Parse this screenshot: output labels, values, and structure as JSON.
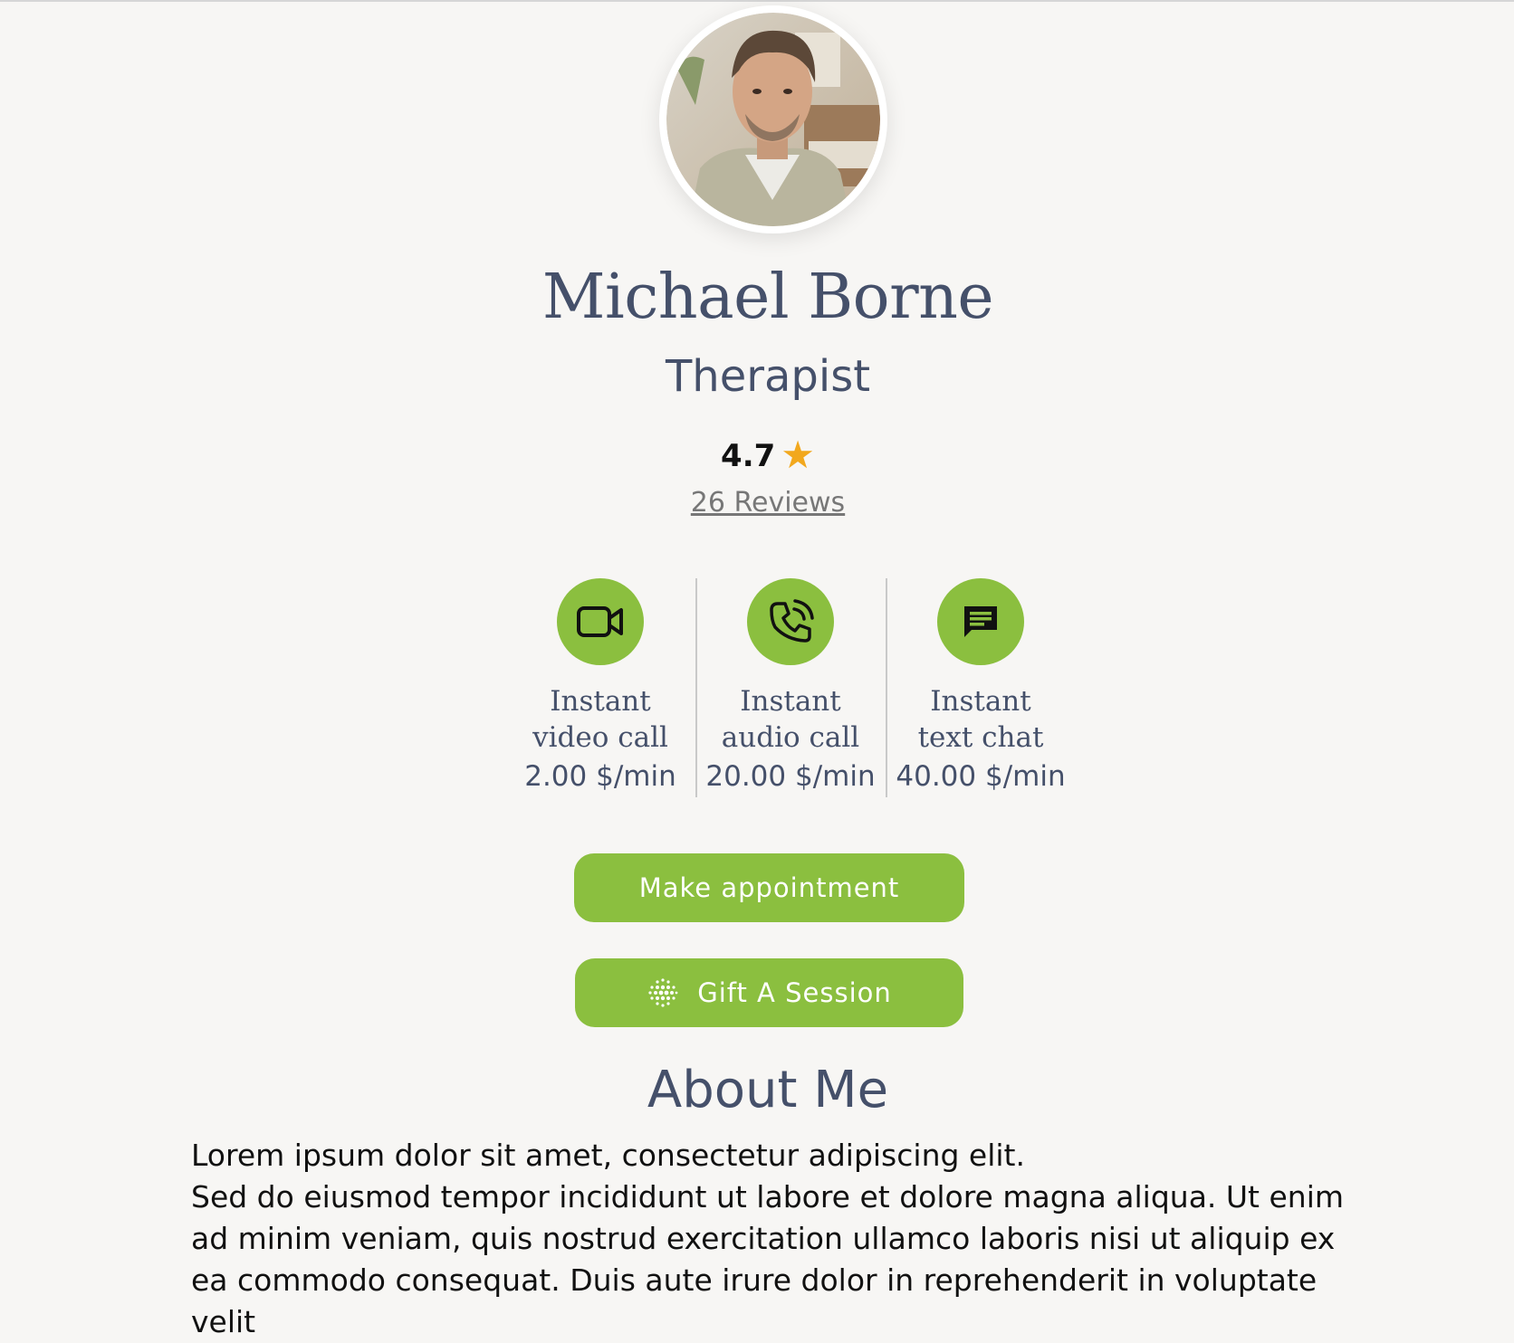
{
  "profile": {
    "name": "Michael Borne",
    "title": "Therapist",
    "rating": "4.7",
    "rating_icon": "star-icon",
    "reviews_label": "26 Reviews",
    "avatar_alt": "Michael Borne"
  },
  "services": [
    {
      "icon": "video-camera-icon",
      "line1": "Instant",
      "line2": "video call",
      "price": "2.00 $/min"
    },
    {
      "icon": "phone-call-icon",
      "line1": "Instant",
      "line2": "audio call",
      "price": "20.00 $/min"
    },
    {
      "icon": "chat-icon",
      "line1": "Instant",
      "line2": "text chat",
      "price": "40.00 $/min"
    }
  ],
  "actions": {
    "appointment_label": "Make appointment",
    "gift_label": "Gift A Session",
    "gift_icon": "dots-gift-icon"
  },
  "about": {
    "heading": "About Me",
    "line1": "Lorem ipsum dolor sit amet, consectetur adipiscing elit.",
    "line2": "Sed do eiusmod tempor incididunt ut labore et dolore magna aliqua. Ut enim ad minim veniam, quis nostrud exercitation ullamco laboris nisi ut aliquip ex ea commodo consequat. Duis aute irure dolor in reprehenderit in voluptate velit"
  },
  "colors": {
    "accent": "#8bbf3f",
    "text": "#45506a",
    "star": "#f2a81d",
    "background": "#f7f6f4"
  }
}
